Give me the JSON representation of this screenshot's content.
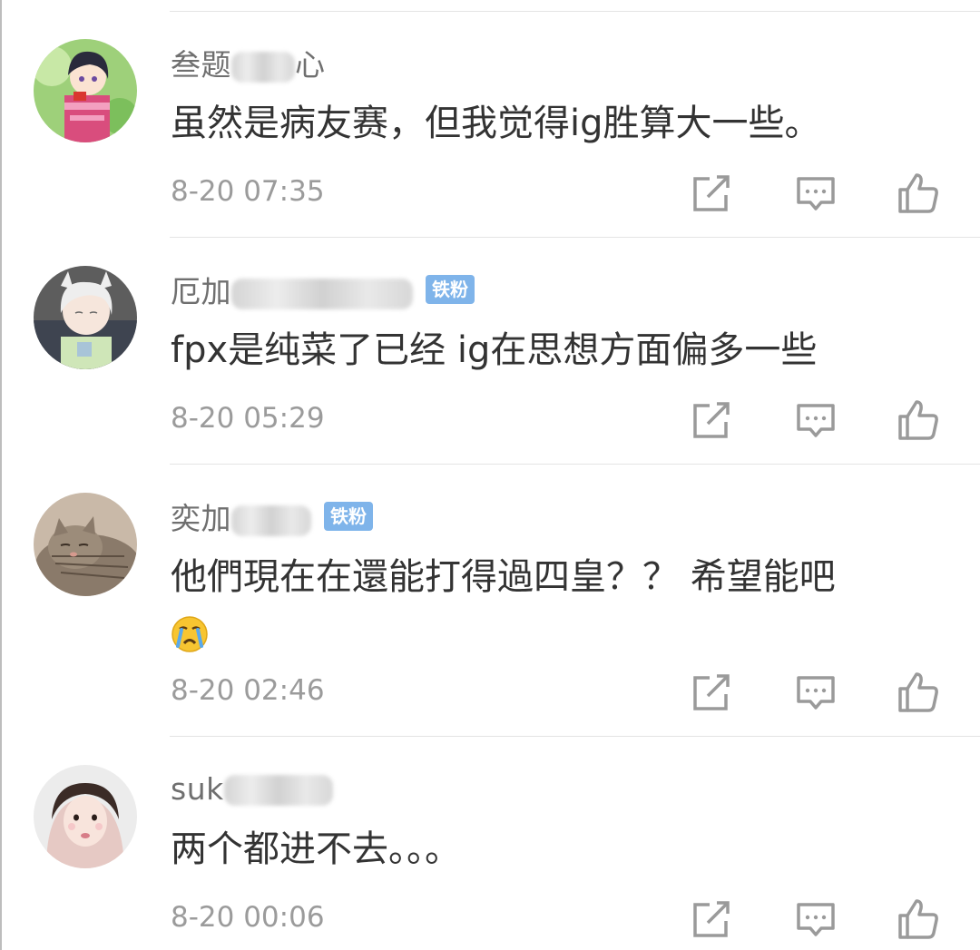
{
  "comments": [
    {
      "username_prefix": "叁题",
      "username_suffix": "心",
      "badge": "",
      "content": "虽然是病友赛，但我觉得ig胜算大一些。",
      "timestamp": "8-20 07:35"
    },
    {
      "username_prefix": "厄加",
      "username_suffix": "",
      "badge": "铁粉",
      "content": "fpx是纯菜了已经 ig在思想方面偏多一些",
      "timestamp": "8-20 05:29"
    },
    {
      "username_prefix": "奕加",
      "username_suffix": "",
      "badge": "铁粉",
      "content": "他們現在在還能打得過四皇？？ 希望能吧",
      "emoji": "crying-face-emoji",
      "timestamp": "8-20 02:46"
    },
    {
      "username_prefix": "suk",
      "username_suffix": "",
      "badge": "",
      "content": "两个都进不去。。。",
      "timestamp": "8-20 00:06"
    }
  ],
  "actions": [
    "repost-icon",
    "comment-icon",
    "like-icon"
  ],
  "colors": {
    "username": "#6f6f6f",
    "content": "#333333",
    "timestamp": "#9b9b9b",
    "badge_bg": "#7fb4ea",
    "icon": "#9a9a9a"
  }
}
